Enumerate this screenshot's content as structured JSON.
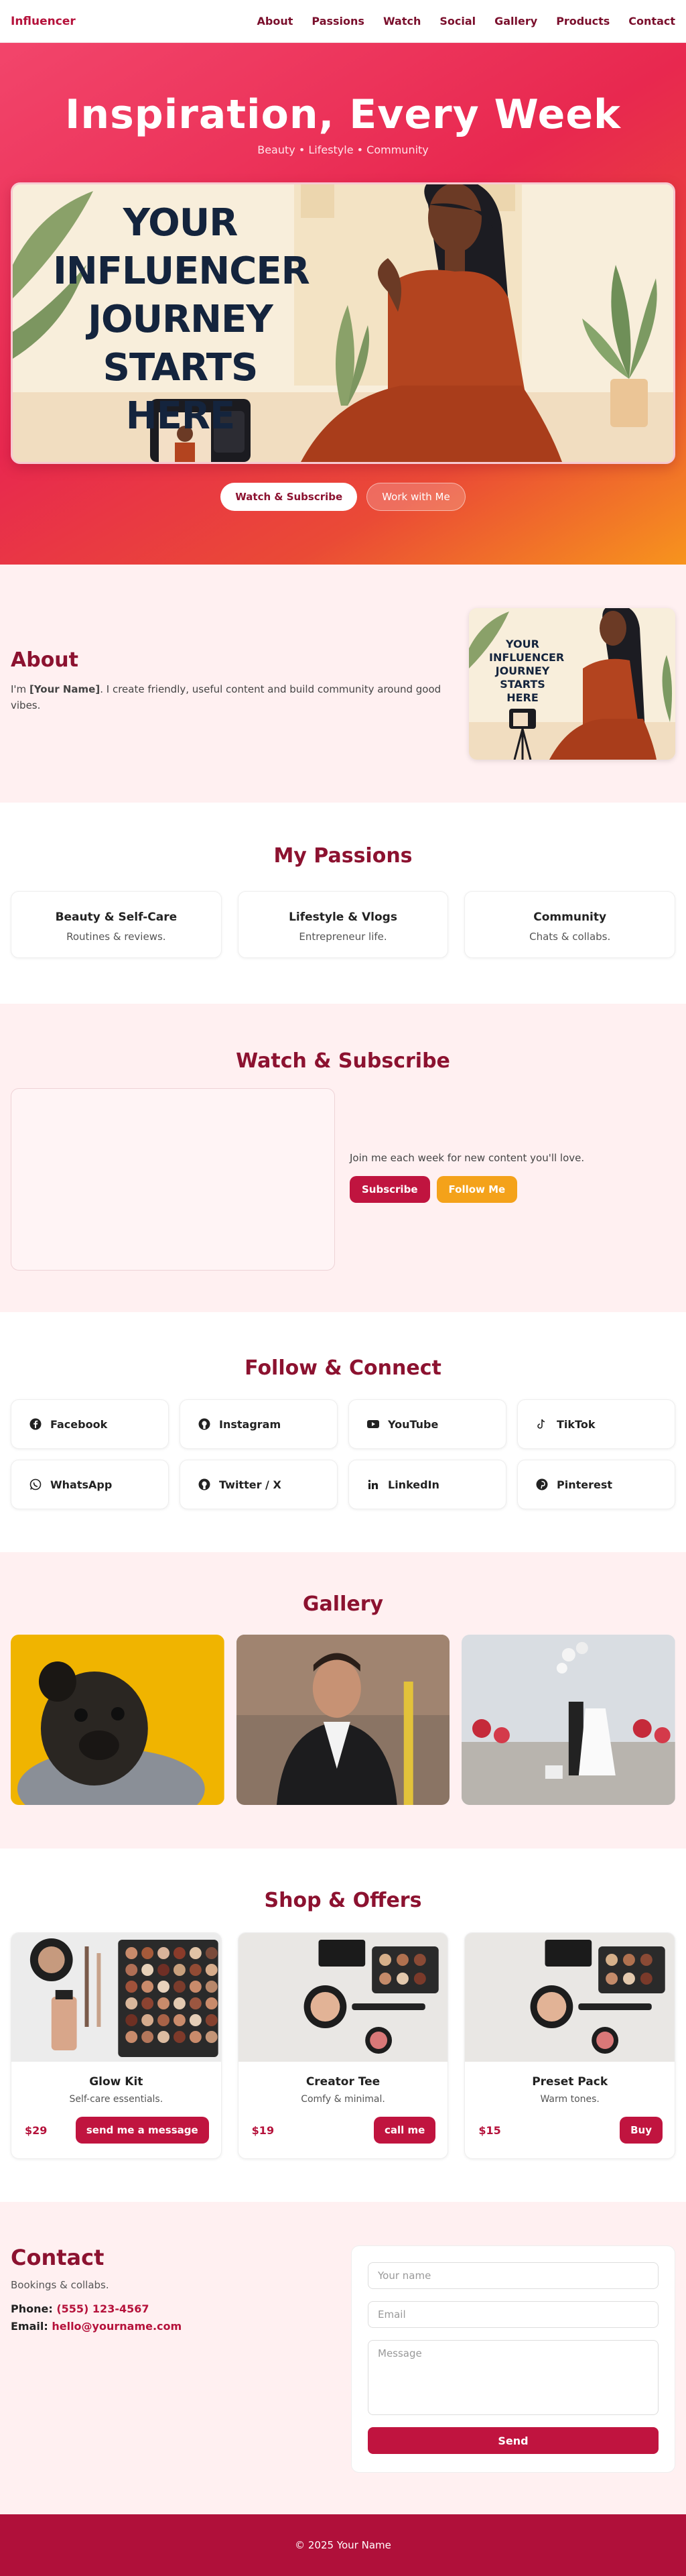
{
  "nav": {
    "brand": "Influencer",
    "links": [
      "About",
      "Passions",
      "Watch",
      "Social",
      "Gallery",
      "Products",
      "Contact"
    ]
  },
  "hero": {
    "title": "Inspiration, Every Week",
    "tagline": "Beauty • Lifestyle • Community",
    "banner_text": "YOUR INFLUENCER JOURNEY STARTS HERE",
    "primary_button": "Watch & Subscribe",
    "secondary_button": "Work with Me"
  },
  "about": {
    "title": "About",
    "text_before": "I'm ",
    "text_bold": "[Your Name]",
    "text_after": ". I create friendly, useful content and build community around good vibes.",
    "image_text": "YOUR INFLUENCER JOURNEY STARTS HERE"
  },
  "passions": {
    "title": "My Passions",
    "items": [
      {
        "title": "Beauty & Self-Care",
        "subtitle": "Routines & reviews."
      },
      {
        "title": "Lifestyle & Vlogs",
        "subtitle": "Entrepreneur life."
      },
      {
        "title": "Community",
        "subtitle": "Chats & collabs."
      }
    ]
  },
  "watch": {
    "title": "Watch & Subscribe",
    "text": "Join me each week for new content you'll love.",
    "subscribe_button": "Subscribe",
    "follow_button": "Follow Me"
  },
  "social": {
    "title": "Follow & Connect",
    "items": [
      {
        "label": "Facebook",
        "icon": "facebook-icon"
      },
      {
        "label": "Instagram",
        "icon": "github-icon"
      },
      {
        "label": "YouTube",
        "icon": "youtube-icon"
      },
      {
        "label": "TikTok",
        "icon": "tiktok-icon"
      },
      {
        "label": "WhatsApp",
        "icon": "whatsapp-icon"
      },
      {
        "label": "Twitter / X",
        "icon": "github-icon"
      },
      {
        "label": "LinkedIn",
        "icon": "linkedin-icon"
      },
      {
        "label": "Pinterest",
        "icon": "pinterest-icon"
      }
    ]
  },
  "gallery": {
    "title": "Gallery"
  },
  "shop": {
    "title": "Shop & Offers",
    "products": [
      {
        "name": "Glow Kit",
        "desc": "Self-care essentials.",
        "price": "$29",
        "button": "send me a message"
      },
      {
        "name": "Creator Tee",
        "desc": "Comfy & minimal.",
        "price": "$19",
        "button": "call me"
      },
      {
        "name": "Preset Pack",
        "desc": "Warm tones.",
        "price": "$15",
        "button": "Buy"
      }
    ]
  },
  "contact": {
    "title": "Contact",
    "subtitle": "Bookings & collabs.",
    "phone_label": "Phone:",
    "phone": "(555) 123-4567",
    "email_label": "Email:",
    "email": "hello@yourname.com",
    "form": {
      "name_placeholder": "Your name",
      "email_placeholder": "Email",
      "message_placeholder": "Message",
      "send_button": "Send"
    }
  },
  "footer": {
    "text": "© 2025 Your Name"
  },
  "colors": {
    "brand": "#b5123b",
    "heading": "#8c1230",
    "accent_orange": "#f4a21a",
    "footer": "#b0103a",
    "pink_bg": "#fff0f1"
  }
}
